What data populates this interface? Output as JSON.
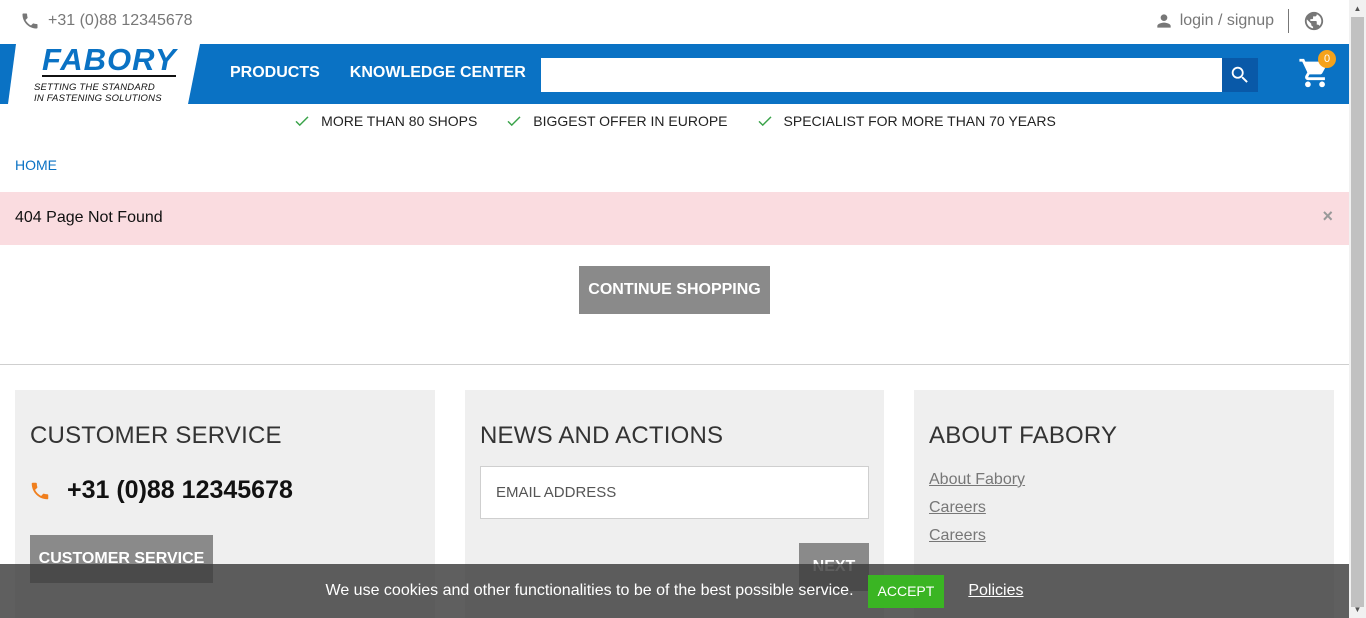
{
  "topbar": {
    "phone": "+31 (0)88 12345678",
    "login_label": "login / signup",
    "icons": {
      "phone": "phone-icon",
      "user": "user-icon",
      "globe": "globe-icon"
    }
  },
  "header": {
    "logo": {
      "word": "FABORY",
      "tagline_line1": "SETTING THE STANDARD",
      "tagline_line2": "IN FASTENING SOLUTIONS"
    },
    "nav": [
      {
        "label": "PRODUCTS"
      },
      {
        "label": "KNOWLEDGE CENTER"
      }
    ],
    "search": {
      "value": "",
      "placeholder": ""
    },
    "cart_count": "0",
    "colors": {
      "brand_blue": "#0a72c4",
      "search_button": "#0959a8",
      "badge": "#f5a21b"
    }
  },
  "usps": [
    {
      "label": "MORE THAN 80 SHOPS"
    },
    {
      "label": "BIGGEST OFFER IN EUROPE"
    },
    {
      "label": "SPECIALIST FOR MORE THAN 70 YEARS"
    }
  ],
  "breadcrumb": {
    "home": "HOME"
  },
  "alert": {
    "message": "404 Page Not Found",
    "close": "×",
    "color": "#fadce0"
  },
  "main": {
    "continue_label": "CONTINUE SHOPPING"
  },
  "footer": {
    "customer_service": {
      "title": "CUSTOMER SERVICE",
      "phone": "+31 (0)88 12345678",
      "button_label": "CUSTOMER SERVICE"
    },
    "news": {
      "title": "NEWS AND ACTIONS",
      "email_placeholder": "EMAIL ADDRESS",
      "next_label": "NEXT"
    },
    "about": {
      "title": "ABOUT FABORY",
      "links": [
        {
          "label": "About Fabory"
        },
        {
          "label": "Careers"
        },
        {
          "label": "Careers"
        }
      ]
    }
  },
  "cookie": {
    "message": "We use cookies and other functionalities to be of the best possible service.",
    "accept_label": "ACCEPT",
    "policies_label": "Policies",
    "accept_color": "#3ab523"
  }
}
